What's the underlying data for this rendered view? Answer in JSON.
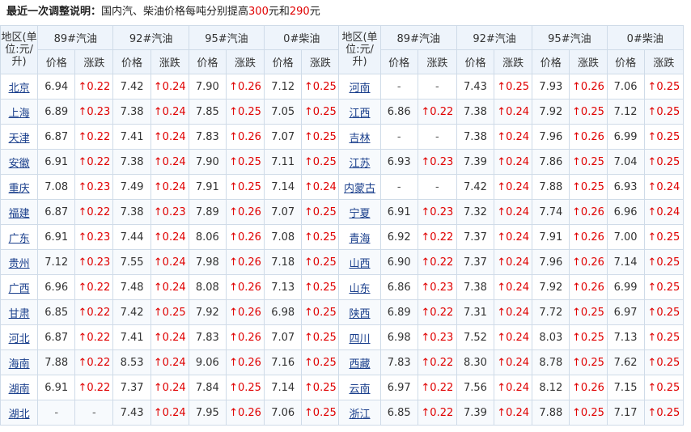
{
  "notice": {
    "label": "最近一次调整说明：",
    "text_before": "国内汽、柴油价格每吨分别提高",
    "gas_increase": "300",
    "text_middle": "元和",
    "diesel_increase": "290",
    "text_after": "元"
  },
  "header": {
    "region": "地区(单位:元/升)",
    "fuels": [
      "89#汽油",
      "92#汽油",
      "95#汽油",
      "0#柴油"
    ],
    "price": "价格",
    "change": "涨跌"
  },
  "rows": [
    {
      "left": {
        "name": "北京",
        "v": [
          "6.94",
          "↑0.22",
          "7.42",
          "↑0.24",
          "7.90",
          "↑0.26",
          "7.12",
          "↑0.25"
        ]
      },
      "right": {
        "name": "河南",
        "v": [
          "-",
          "-",
          "7.43",
          "↑0.25",
          "7.93",
          "↑0.26",
          "7.06",
          "↑0.25"
        ]
      }
    },
    {
      "left": {
        "name": "上海",
        "v": [
          "6.89",
          "↑0.23",
          "7.38",
          "↑0.24",
          "7.85",
          "↑0.25",
          "7.05",
          "↑0.25"
        ]
      },
      "right": {
        "name": "江西",
        "v": [
          "6.86",
          "↑0.22",
          "7.38",
          "↑0.24",
          "7.92",
          "↑0.25",
          "7.12",
          "↑0.25"
        ]
      }
    },
    {
      "left": {
        "name": "天津",
        "v": [
          "6.87",
          "↑0.22",
          "7.41",
          "↑0.24",
          "7.83",
          "↑0.26",
          "7.07",
          "↑0.25"
        ]
      },
      "right": {
        "name": "吉林",
        "v": [
          "-",
          "-",
          "7.38",
          "↑0.24",
          "7.96",
          "↑0.26",
          "6.99",
          "↑0.25"
        ]
      }
    },
    {
      "left": {
        "name": "安徽",
        "v": [
          "6.91",
          "↑0.22",
          "7.38",
          "↑0.24",
          "7.90",
          "↑0.25",
          "7.11",
          "↑0.25"
        ]
      },
      "right": {
        "name": "江苏",
        "v": [
          "6.93",
          "↑0.23",
          "7.39",
          "↑0.24",
          "7.86",
          "↑0.25",
          "7.04",
          "↑0.25"
        ]
      }
    },
    {
      "left": {
        "name": "重庆",
        "v": [
          "7.08",
          "↑0.23",
          "7.49",
          "↑0.24",
          "7.91",
          "↑0.25",
          "7.14",
          "↑0.24"
        ]
      },
      "right": {
        "name": "内蒙古",
        "v": [
          "-",
          "-",
          "7.42",
          "↑0.24",
          "7.88",
          "↑0.25",
          "6.93",
          "↑0.24"
        ]
      }
    },
    {
      "left": {
        "name": "福建",
        "v": [
          "6.87",
          "↑0.22",
          "7.38",
          "↑0.23",
          "7.89",
          "↑0.26",
          "7.07",
          "↑0.25"
        ]
      },
      "right": {
        "name": "宁夏",
        "v": [
          "6.91",
          "↑0.23",
          "7.32",
          "↑0.24",
          "7.74",
          "↑0.26",
          "6.96",
          "↑0.24"
        ]
      }
    },
    {
      "left": {
        "name": "广东",
        "v": [
          "6.91",
          "↑0.23",
          "7.44",
          "↑0.24",
          "8.06",
          "↑0.26",
          "7.08",
          "↑0.25"
        ]
      },
      "right": {
        "name": "青海",
        "v": [
          "6.92",
          "↑0.22",
          "7.37",
          "↑0.24",
          "7.91",
          "↑0.26",
          "7.00",
          "↑0.25"
        ]
      }
    },
    {
      "left": {
        "name": "贵州",
        "v": [
          "7.12",
          "↑0.23",
          "7.55",
          "↑0.24",
          "7.98",
          "↑0.26",
          "7.18",
          "↑0.25"
        ]
      },
      "right": {
        "name": "山西",
        "v": [
          "6.90",
          "↑0.22",
          "7.37",
          "↑0.24",
          "7.96",
          "↑0.26",
          "7.14",
          "↑0.25"
        ]
      }
    },
    {
      "left": {
        "name": "广西",
        "v": [
          "6.96",
          "↑0.22",
          "7.48",
          "↑0.24",
          "8.08",
          "↑0.26",
          "7.13",
          "↑0.25"
        ]
      },
      "right": {
        "name": "山东",
        "v": [
          "6.86",
          "↑0.23",
          "7.38",
          "↑0.24",
          "7.92",
          "↑0.26",
          "6.99",
          "↑0.25"
        ]
      }
    },
    {
      "left": {
        "name": "甘肃",
        "v": [
          "6.85",
          "↑0.22",
          "7.42",
          "↑0.25",
          "7.92",
          "↑0.26",
          "6.98",
          "↑0.25"
        ]
      },
      "right": {
        "name": "陕西",
        "v": [
          "6.89",
          "↑0.22",
          "7.31",
          "↑0.24",
          "7.72",
          "↑0.25",
          "6.97",
          "↑0.25"
        ]
      }
    },
    {
      "left": {
        "name": "河北",
        "v": [
          "6.87",
          "↑0.22",
          "7.41",
          "↑0.24",
          "7.83",
          "↑0.26",
          "7.07",
          "↑0.25"
        ]
      },
      "right": {
        "name": "四川",
        "v": [
          "6.98",
          "↑0.23",
          "7.52",
          "↑0.24",
          "8.03",
          "↑0.25",
          "7.13",
          "↑0.25"
        ]
      }
    },
    {
      "left": {
        "name": "海南",
        "v": [
          "7.88",
          "↑0.22",
          "8.53",
          "↑0.24",
          "9.06",
          "↑0.26",
          "7.16",
          "↑0.25"
        ]
      },
      "right": {
        "name": "西藏",
        "v": [
          "7.83",
          "↑0.22",
          "8.30",
          "↑0.24",
          "8.78",
          "↑0.25",
          "7.62",
          "↑0.25"
        ]
      }
    },
    {
      "left": {
        "name": "湖南",
        "v": [
          "6.91",
          "↑0.22",
          "7.37",
          "↑0.24",
          "7.84",
          "↑0.25",
          "7.14",
          "↑0.25"
        ]
      },
      "right": {
        "name": "云南",
        "v": [
          "6.97",
          "↑0.22",
          "7.56",
          "↑0.24",
          "8.12",
          "↑0.26",
          "7.15",
          "↑0.25"
        ]
      }
    },
    {
      "left": {
        "name": "湖北",
        "v": [
          "-",
          "-",
          "7.43",
          "↑0.24",
          "7.95",
          "↑0.26",
          "7.06",
          "↑0.25"
        ]
      },
      "right": {
        "name": "浙江",
        "v": [
          "6.85",
          "↑0.22",
          "7.39",
          "↑0.24",
          "7.88",
          "↑0.25",
          "7.17",
          "↑0.25"
        ]
      }
    }
  ]
}
